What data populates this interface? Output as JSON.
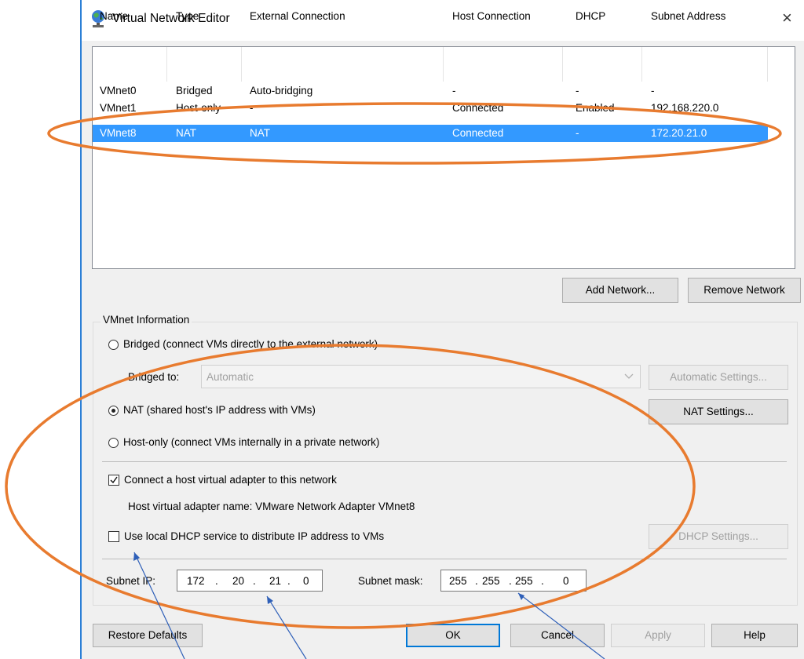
{
  "window": {
    "title": "Virtual Network Editor",
    "close_glyph": "×"
  },
  "table": {
    "headers": [
      "Name",
      "Type",
      "External Connection",
      "Host Connection",
      "DHCP",
      "Subnet Address"
    ],
    "rows": [
      [
        "VMnet0",
        "Bridged",
        "Auto-bridging",
        "-",
        "-",
        "-"
      ],
      [
        "VMnet1",
        "Host-only",
        "-",
        "Connected",
        "Enabled",
        "192.168.220.0"
      ],
      [
        "VMnet8",
        "NAT",
        "NAT",
        "Connected",
        "-",
        "172.20.21.0"
      ]
    ],
    "selected_row": 2
  },
  "buttons": {
    "add_network": "Add Network...",
    "remove_network": "Remove Network",
    "automatic_settings": "Automatic Settings...",
    "nat_settings": "NAT Settings...",
    "dhcp_settings": "DHCP Settings...",
    "restore_defaults": "Restore Defaults",
    "ok": "OK",
    "cancel": "Cancel",
    "apply": "Apply",
    "help": "Help"
  },
  "vmnet_info": {
    "group_label": "VMnet Information",
    "bridged_label": "Bridged (connect VMs directly to the external network)",
    "bridged_to_label": "Bridged to:",
    "bridged_to_value": "Automatic",
    "nat_label": "NAT (shared host's IP address with VMs)",
    "host_only_label": "Host-only (connect VMs internally in a private network)",
    "selected_mode": "NAT",
    "connect_adapter_label": "Connect a host virtual adapter to this network",
    "connect_adapter_checked": true,
    "adapter_name_label": "Host virtual adapter name: VMware Network Adapter VMnet8",
    "dhcp_label": "Use local DHCP service to distribute IP address to VMs",
    "dhcp_checked": false,
    "subnet_ip_label": "Subnet IP:",
    "subnet_ip": [
      "172",
      "20",
      "21",
      "0"
    ],
    "subnet_mask_label": "Subnet mask:",
    "subnet_mask": [
      "255",
      "255",
      "255",
      "0"
    ],
    "ip_dot": "."
  },
  "annotation_colors": {
    "ellipse": "#e87b2f",
    "arrow": "#2e5fb8"
  },
  "icons": {
    "title": "network-globe-icon",
    "combo_arrow": "chevron-down-icon"
  }
}
